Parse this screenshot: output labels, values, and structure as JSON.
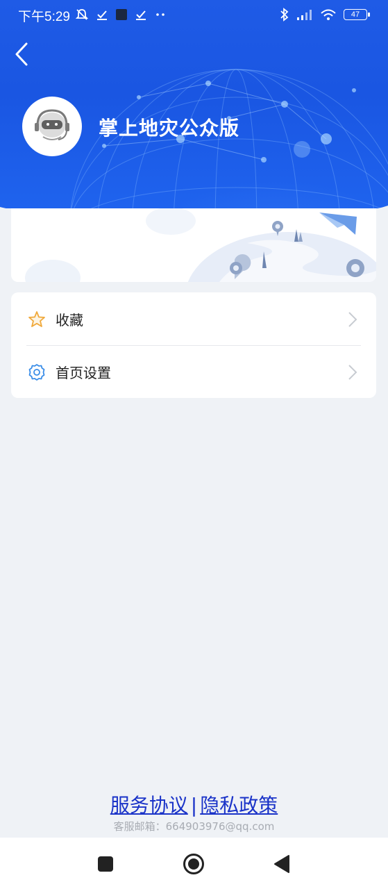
{
  "status_bar": {
    "time": "下午5:29",
    "battery": "47",
    "left_icons": [
      "mute-bell-icon",
      "check-icon",
      "square-app-icon",
      "check-icon",
      "more-dots-icon"
    ],
    "right_icons": [
      "bluetooth-icon",
      "signal-icon",
      "wifi-icon",
      "battery-icon"
    ]
  },
  "header": {
    "title": "掌上地灾公众版",
    "accent": "#1f5be6"
  },
  "menu": {
    "items": [
      {
        "label": "收藏",
        "icon": "star-icon",
        "icon_color": "#f0a93b"
      },
      {
        "label": "首页设置",
        "icon": "gear-icon",
        "icon_color": "#3a8de8"
      }
    ]
  },
  "footer": {
    "service_agreement": "服务协议",
    "separator": "|",
    "privacy_policy": "隐私政策",
    "support_email": "客服邮箱：664903976@qq.com",
    "link_color": "#1a33c8"
  },
  "nav_bar": {
    "buttons": [
      "recent-apps-icon",
      "home-icon",
      "back-triangle-icon"
    ]
  }
}
